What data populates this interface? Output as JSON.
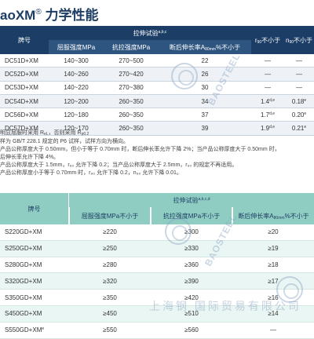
{
  "title": {
    "prefix": "aoXM",
    "reg": "®",
    "suffix": " 力学性能"
  },
  "table1": {
    "grade_header": "牌号",
    "tensile_header": "拉伸试验",
    "tensile_sup": "a,b,c",
    "yield_header": "屈服强度MPa",
    "strength_header": "抗拉强度MPa",
    "elong_header": "断后伸长率A",
    "elong_sub": "80mm",
    "elong_suffix": "%不小于",
    "r_header_pre": "r",
    "r_header_sub": "90",
    "r_header_suf": "不小于",
    "n_header_pre": "n",
    "n_header_sub": "90",
    "n_header_suf": "不小于",
    "rows": [
      {
        "grade": "DC51D+XM",
        "yield": "140~300",
        "strength": "270~500",
        "elong": "22",
        "r": "—",
        "n": "—"
      },
      {
        "grade": "DC52D+XM",
        "yield": "140~260",
        "strength": "270~420",
        "elong": "26",
        "r": "—",
        "n": "—"
      },
      {
        "grade": "DC53D+XM",
        "yield": "140~220",
        "strength": "270~380",
        "elong": "30",
        "r": "—",
        "n": "—"
      },
      {
        "grade": "DC54D+XM",
        "yield": "120~200",
        "strength": "260~350",
        "elong": "34",
        "r": "1.4",
        "r_sup": "d,e",
        "n": "0.18",
        "n_sup": "e"
      },
      {
        "grade": "DC56D+XM",
        "yield": "120~180",
        "strength": "260~350",
        "elong": "37",
        "r": "1.7",
        "r_sup": "d,e",
        "n": "0.20",
        "n_sup": "e"
      },
      {
        "grade": "DC57D+XM",
        "yield": "120~170",
        "strength": "260~350",
        "elong": "39",
        "r": "1.9",
        "r_sup": "d,e",
        "n": "0.21",
        "n_sup": "e"
      }
    ]
  },
  "notes": [
    "明显屈服时采用 R",
    "样为 GB/T 228.1 规定的 P6 试样，试样方向为横向。",
    "产品公称厚度大于 0.50mm，但小于等于 0.70mm 时，断后伸长率允许下降 2%；当产品公称厚度大于 0.50mm 时，",
    "后伸长率允许下降 4%。",
    "产品公称厚度大于 1.5mm，r₉₀ 允许下降 0.2；当产品公称厚度大于 2.5mm，r₉₀ 的规定不再适用。",
    "产品公称厚度小于等于 0.70mm 时，r₉₀ 允许下降 0.2，n₉₀ 允许下降 0.01。"
  ],
  "note1_suffix_a": "，否则采用 R",
  "table2": {
    "grade_header": "牌号",
    "tensile_header": "拉伸试验",
    "tensile_sup": "a,b,c,d",
    "yield_header": "屈服强度MPa不小于",
    "strength_header": "抗拉强度MPa不小于",
    "elong_header": "断后伸长率A",
    "elong_sub": "80mm",
    "elong_suffix": "%不小于",
    "rows": [
      {
        "grade": "S220GD+XM",
        "yield": "≥220",
        "strength": "≥300",
        "elong": "≥20"
      },
      {
        "grade": "S250GD+XM",
        "yield": "≥250",
        "strength": "≥330",
        "elong": "≥19"
      },
      {
        "grade": "S280GD+XM",
        "yield": "≥280",
        "strength": "≥360",
        "elong": "≥18"
      },
      {
        "grade": "S320GD+XM",
        "yield": "≥320",
        "strength": "≥390",
        "elong": "≥17"
      },
      {
        "grade": "S350GD+XM",
        "yield": "≥350",
        "strength": "≥420",
        "elong": "≥16"
      },
      {
        "grade": "S450GD+XM",
        "yield": "≥450",
        "strength": "≥510",
        "elong": "≥14"
      },
      {
        "grade": "S550GD+XM",
        "grade_sup": "e",
        "yield": "≥550",
        "strength": "≥560",
        "elong": "—"
      }
    ]
  },
  "watermark": {
    "brand": "BAOSTEEL",
    "footer": "上海钢 国际贸易有限公司"
  }
}
